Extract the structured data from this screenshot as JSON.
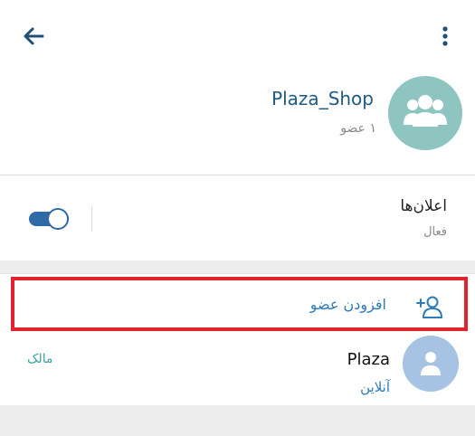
{
  "header": {
    "back_icon": "arrow-left-icon",
    "menu_icon": "more-vertical-icon"
  },
  "group": {
    "name": "Plaza_Shop",
    "member_count": "۱ عضو",
    "avatar_icon": "group-people-icon",
    "avatar_color": "#8fc5c0"
  },
  "notifications": {
    "title": "اعلان‌ها",
    "status": "فعال",
    "toggle_on": true,
    "accent_color": "#2e6aa8"
  },
  "members": {
    "add_member_label": "افزودن عضو",
    "add_member_icon": "add-user-icon",
    "highlight_color": "#e0232f",
    "items": [
      {
        "name": "Plaza",
        "status": "آنلاین",
        "role": "مالک",
        "avatar_icon": "user-icon",
        "avatar_color": "#a6c3e4"
      }
    ]
  }
}
